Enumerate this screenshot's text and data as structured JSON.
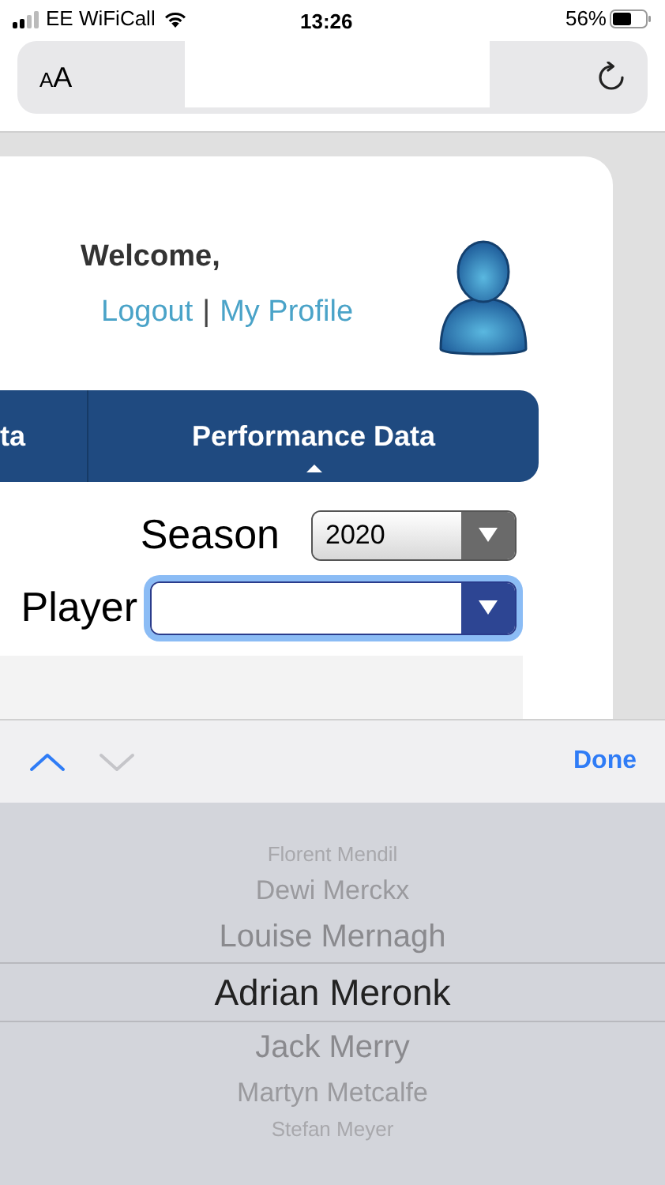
{
  "status_bar": {
    "carrier": "EE WiFiCall",
    "time": "13:26",
    "battery": "56%"
  },
  "address_bar": {
    "text_size_button": "AA"
  },
  "welcome": {
    "greeting": "Welcome,",
    "links": [
      "Logout",
      "My Profile"
    ],
    "separator": "|"
  },
  "nav": {
    "tabs": [
      {
        "label": "ta",
        "selected": false
      },
      {
        "label": "Performance Data",
        "selected": true
      }
    ]
  },
  "form": {
    "fields": [
      {
        "label": "Season",
        "value": "2020",
        "focused": false
      },
      {
        "label": "Player",
        "focused": true
      }
    ]
  },
  "keyboard_toolbar": {
    "nav_buttons": [
      {
        "kind": "previous",
        "disabled": false
      },
      {
        "kind": "next",
        "disabled": true
      }
    ],
    "done": "Done"
  },
  "picker": {
    "options": [
      {
        "label": "Florent Mendil",
        "selected": false
      },
      {
        "label": "Dewi Merckx",
        "selected": false
      },
      {
        "label": "Louise Mernagh",
        "selected": false
      },
      {
        "label": "Adrian Meronk",
        "selected": true
      },
      {
        "label": "Jack Merry",
        "selected": false
      },
      {
        "label": "Martyn Metcalfe",
        "selected": false
      },
      {
        "label": "Stefan Meyer",
        "selected": false
      }
    ]
  }
}
